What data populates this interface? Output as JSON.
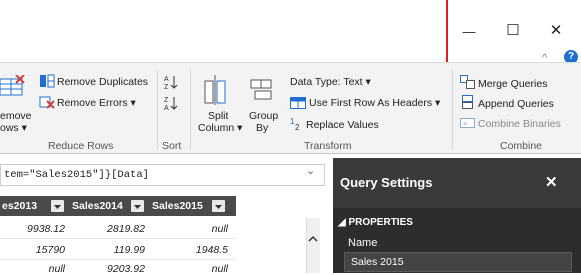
{
  "window": {
    "minimize_glyph": "—",
    "maximize_glyph": "☐",
    "close_glyph": "✕",
    "collapse_glyph": "^",
    "help_glyph": "?"
  },
  "ribbon": {
    "remove_duplicates": "Remove Duplicates",
    "remove_errors": "Remove Errors ▾",
    "remove_rows_line1": "emove",
    "remove_rows_line2": "ows ▾",
    "reduce_rows_group": "Reduce Rows",
    "sort_group": "Sort",
    "split_column_line1": "Split",
    "split_column_line2": "Column ▾",
    "group_by_line1": "Group",
    "group_by_line2": "By",
    "data_type": "Data Type: Text ▾",
    "first_row_headers": "Use First Row As Headers ▾",
    "replace_values": "Replace Values",
    "transform_group": "Transform",
    "merge_queries": "Merge Queries",
    "append_queries": "Append Queries",
    "combine_binaries": "Combine Binaries",
    "combine_group": "Combine"
  },
  "formula": {
    "text": "tem=\"Sales2015\"]}[Data]",
    "dropdown_glyph": "⌄"
  },
  "grid": {
    "columns": [
      "es2013",
      "Sales2014",
      "Sales2015"
    ],
    "rows": [
      [
        "9938.12",
        "2819.82",
        "null"
      ],
      [
        "15790",
        "119.99",
        "1948.5"
      ],
      [
        "null",
        "9203.92",
        "null"
      ]
    ]
  },
  "query_settings": {
    "title": "Query Settings",
    "close_glyph": "✕",
    "properties_label": "◢ PROPERTIES",
    "name_label": "Name",
    "name_value": "Sales 2015"
  },
  "colors": {
    "annotation": "#e02020",
    "accent_blue": "#1f6fd1",
    "dark_panel": "#2d2d2d"
  }
}
